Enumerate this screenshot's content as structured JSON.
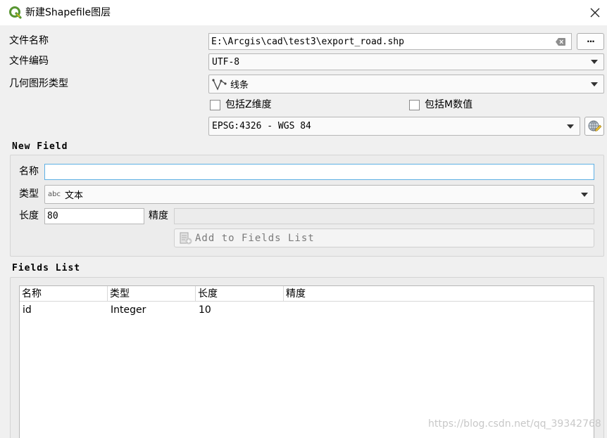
{
  "window": {
    "title": "新建Shapefile图层",
    "close_glyph": "✕"
  },
  "form": {
    "file_name_label": "文件名称",
    "file_name_value": "E:\\Arcgis\\cad\\test3\\export_road.shp",
    "browse_label": "···",
    "encoding_label": "文件编码",
    "encoding_value": "UTF-8",
    "geometry_label": "几何图形类型",
    "geometry_value": "线条",
    "include_z_label": "包括Z维度",
    "include_m_label": "包括M数值",
    "crs_value": "EPSG:4326 - WGS 84"
  },
  "new_field": {
    "title": "New Field",
    "name_label": "名称",
    "name_value": "",
    "type_label": "类型",
    "type_icon_text": "abc",
    "type_value": "文本",
    "length_label": "长度",
    "length_value": "80",
    "precision_label": "精度",
    "precision_value": "",
    "add_button_label": "Add to Fields List"
  },
  "fields_list": {
    "title": "Fields List",
    "columns": [
      "名称",
      "类型",
      "长度",
      "精度"
    ],
    "rows": [
      [
        "id",
        "Integer",
        "10",
        ""
      ]
    ]
  },
  "watermark": "https://blog.csdn.net/qq_39342768",
  "colors": {
    "qgis_green": "#589632",
    "qgis_yellow": "#ee7913",
    "focus_border": "#5eb0e5"
  }
}
